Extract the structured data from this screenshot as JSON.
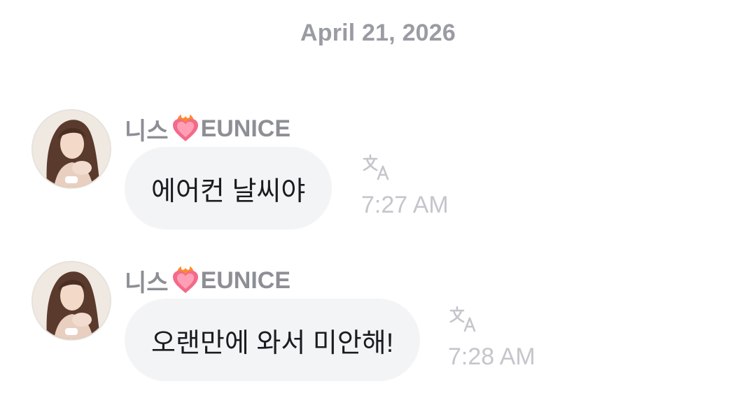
{
  "date_divider": "April 21, 2026",
  "messages": [
    {
      "sender": {
        "name_prefix": "니스",
        "emoji": "heart-on-fire",
        "name_suffix": "EUNICE"
      },
      "text": "에어컨 날씨야",
      "time": "7:27 AM",
      "translate_icon": "translate-icon"
    },
    {
      "sender": {
        "name_prefix": "니스",
        "emoji": "heart-on-fire",
        "name_suffix": "EUNICE"
      },
      "text": "오랜만에 와서 미안해!",
      "time": "7:28 AM",
      "translate_icon": "translate-icon"
    }
  ],
  "colors": {
    "bubble": "#f3f4f6",
    "sender_name": "#8d8f95",
    "timestamp": "#c4c6cb",
    "date": "#9a9ca3",
    "text": "#1b1c1f"
  }
}
